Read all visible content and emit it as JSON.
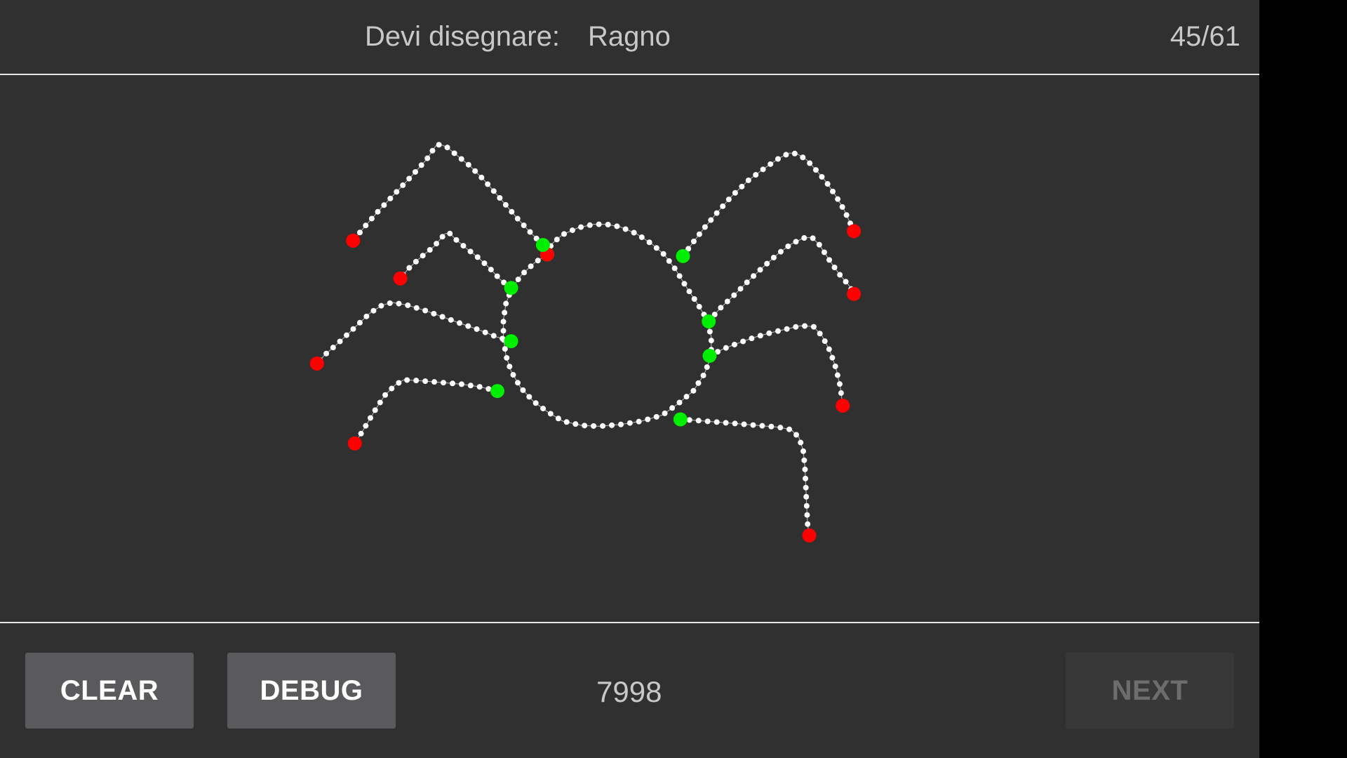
{
  "header": {
    "prompt_label": "Devi disegnare:",
    "prompt_word": "Ragno",
    "progress": "45/61"
  },
  "footer": {
    "clear_label": "CLEAR",
    "debug_label": "DEBUG",
    "score": "7998",
    "next_label": "NEXT"
  },
  "colors": {
    "background": "#303030",
    "stroke_point": "#ffffff",
    "stroke_start": "#00ee00",
    "stroke_end": "#ff0000",
    "button": "#5a5a5c",
    "button_disabled": "#383838"
  }
}
